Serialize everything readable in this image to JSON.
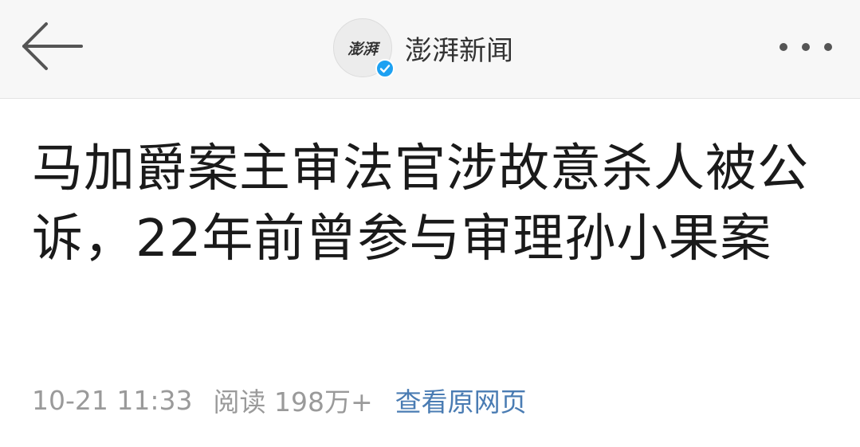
{
  "header": {
    "account_name": "澎湃新闻",
    "avatar_text": "澎湃",
    "back_icon": "arrow-left-icon",
    "more_icon": "more-dots-icon",
    "verified_icon": "verified-check-icon",
    "verified_color": "#1da1f2"
  },
  "article": {
    "title": "马加爵案主审法官涉故意杀人被公诉，22年前曾参与审理孙小果案",
    "timestamp": "10-21 11:33",
    "reads": "阅读 198万+",
    "view_original_label": "查看原网页",
    "link_color": "#4a7cb3"
  }
}
